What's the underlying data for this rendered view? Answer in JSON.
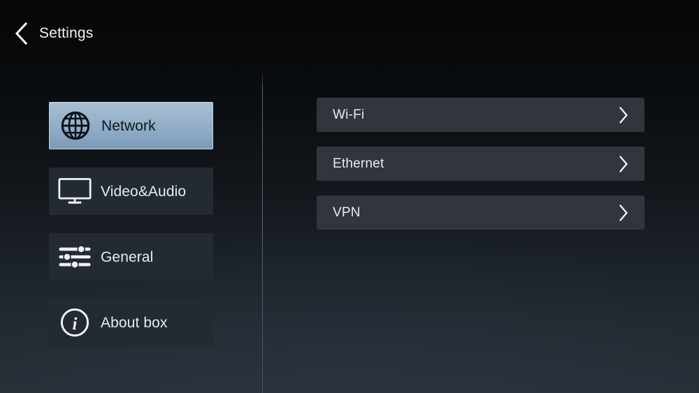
{
  "header": {
    "title": "Settings",
    "back_icon": "chevron-left-icon"
  },
  "sidebar": {
    "items": [
      {
        "label": "Network",
        "icon": "globe-icon",
        "selected": true
      },
      {
        "label": "Video&Audio",
        "icon": "monitor-icon",
        "selected": false
      },
      {
        "label": "General",
        "icon": "sliders-icon",
        "selected": false
      },
      {
        "label": "About box",
        "icon": "info-circle-icon",
        "selected": false
      }
    ]
  },
  "panel": {
    "rows": [
      {
        "label": "Wi-Fi",
        "chevron": "chevron-right-icon"
      },
      {
        "label": "Ethernet",
        "chevron": "chevron-right-icon"
      },
      {
        "label": "VPN",
        "chevron": "chevron-right-icon"
      }
    ]
  },
  "colors": {
    "background_top": "#050607",
    "background_bottom": "#262d35",
    "selected_item_light": "#a7bed3",
    "selected_item_dark": "#7b99b8",
    "sidebar_item_bg": "#242a32",
    "panel_row_bg": "#31353e",
    "text": "#e9edf1",
    "divider": "#607c88"
  }
}
